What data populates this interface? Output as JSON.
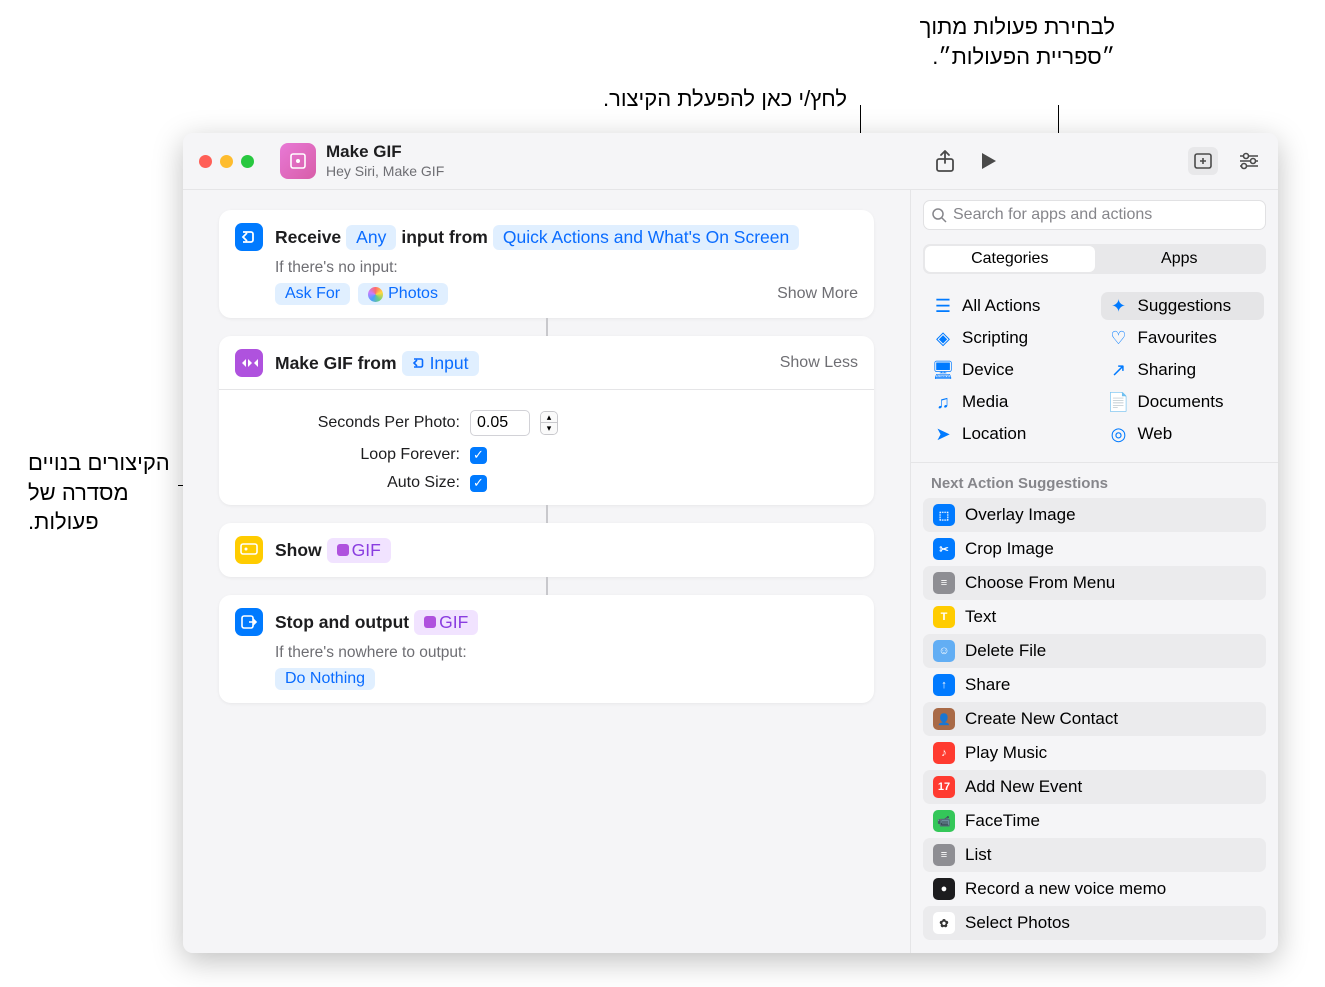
{
  "callouts": {
    "library": "לבחירת פעולות מתוך ״ספריית הפעולות״.",
    "run": "לחץ/י כאן להפעלת הקיצור.",
    "editor": "הקיצורים בנויים מסדרה של פעולות."
  },
  "header": {
    "title": "Make GIF",
    "subtitle": "Hey Siri, Make GIF"
  },
  "actions": {
    "receive": {
      "label": "Receive",
      "token_any": "Any",
      "label_middle": "input from",
      "token_source": "Quick Actions and What's On Screen",
      "no_input_label": "If there's no input:",
      "ask_for": "Ask For",
      "photos": "Photos",
      "show_more": "Show More"
    },
    "make_gif": {
      "title": "Make GIF from",
      "token_input": "Input",
      "show_less": "Show Less",
      "sec_label": "Seconds Per Photo:",
      "sec_value": "0.05",
      "loop_label": "Loop Forever:",
      "auto_label": "Auto Size:"
    },
    "show": {
      "title": "Show",
      "gif": "GIF"
    },
    "stop": {
      "title": "Stop and output",
      "gif": "GIF",
      "nowhere": "If there's nowhere to output:",
      "do_nothing": "Do Nothing"
    }
  },
  "sidebar": {
    "search_placeholder": "Search for apps and actions",
    "tab_categories": "Categories",
    "tab_apps": "Apps",
    "categories": [
      {
        "icon": "☰",
        "label": "All Actions"
      },
      {
        "icon": "✦",
        "label": "Suggestions",
        "selected": true
      },
      {
        "icon": "◈",
        "label": "Scripting"
      },
      {
        "icon": "♡",
        "label": "Favourites"
      },
      {
        "icon": "🖥",
        "label": "Device"
      },
      {
        "icon": "↗",
        "label": "Sharing"
      },
      {
        "icon": "♫",
        "label": "Media"
      },
      {
        "icon": "📄",
        "label": "Documents"
      },
      {
        "icon": "➤",
        "label": "Location"
      },
      {
        "icon": "◎",
        "label": "Web"
      }
    ],
    "suggest_header": "Next Action Suggestions",
    "suggestions": [
      {
        "bg": "#007aff",
        "icon": "⬚",
        "label": "Overlay Image"
      },
      {
        "bg": "#007aff",
        "icon": "✂",
        "label": "Crop Image"
      },
      {
        "bg": "#8e8e93",
        "icon": "≡",
        "label": "Choose From Menu"
      },
      {
        "bg": "#ffcc00",
        "icon": "T",
        "label": "Text"
      },
      {
        "bg": "#62aef4",
        "icon": "☺",
        "label": "Delete File"
      },
      {
        "bg": "#007aff",
        "icon": "↑",
        "label": "Share"
      },
      {
        "bg": "#a96a47",
        "icon": "👤",
        "label": "Create New Contact"
      },
      {
        "bg": "#ff3b30",
        "icon": "♪",
        "label": "Play Music"
      },
      {
        "bg": "#ff3b30",
        "icon": "17",
        "label": "Add New Event"
      },
      {
        "bg": "#34c759",
        "icon": "📹",
        "label": "FaceTime"
      },
      {
        "bg": "#8e8e93",
        "icon": "≡",
        "label": "List"
      },
      {
        "bg": "#1c1c1e",
        "icon": "●",
        "label": "Record a new voice memo"
      },
      {
        "bg": "#ffffff",
        "icon": "✿",
        "label": "Select Photos"
      }
    ]
  }
}
